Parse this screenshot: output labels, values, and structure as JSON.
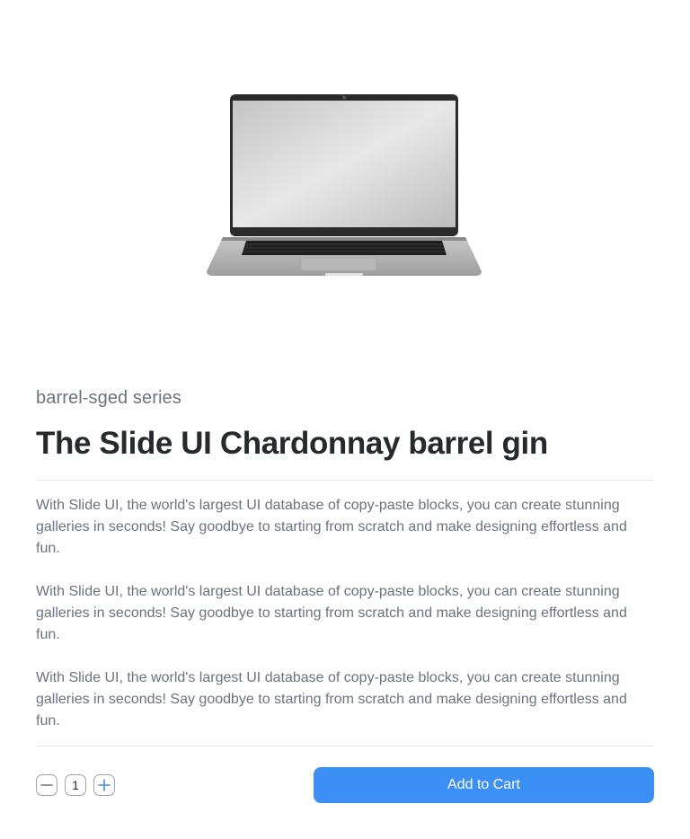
{
  "product": {
    "image_alt": "laptop",
    "series": "barrel-sged series",
    "title": "The Slide UI Chardonnay barrel gin",
    "description": [
      "With Slide UI, the world's largest UI database of copy-paste blocks, you can create stunning galleries in seconds! Say goodbye to starting from scratch and make designing effortless and fun.",
      "With Slide UI, the world's largest UI database of copy-paste blocks, you can create stunning galleries in seconds! Say goodbye to starting from scratch and make designing effortless and fun.",
      "With Slide UI, the world's largest UI database of copy-paste blocks, you can create stunning galleries in seconds! Say goodbye to starting from scratch and make designing effortless and fun."
    ]
  },
  "quantity": {
    "value": "1",
    "decrement_icon": "minus-icon",
    "increment_icon": "plus-icon"
  },
  "actions": {
    "add_to_cart_label": "Add to Cart"
  },
  "colors": {
    "accent": "#3b8ff5",
    "title": "#262a2e",
    "muted_text": "#6b7280",
    "divider": "#e5e7eb"
  }
}
